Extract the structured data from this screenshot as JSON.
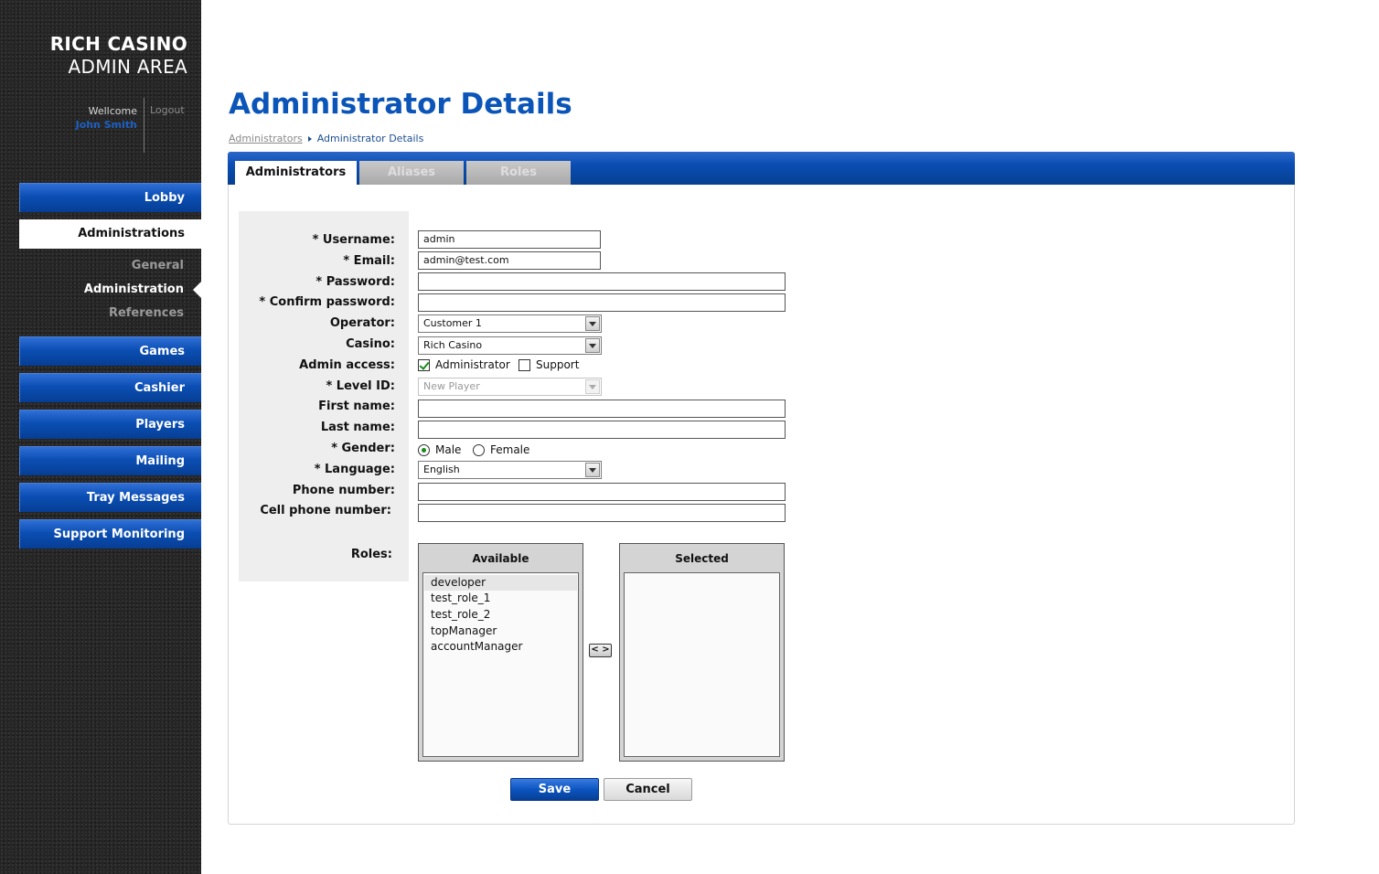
{
  "sidebar": {
    "brand_line1": "RICH CASINO",
    "brand_line2": "ADMIN AREA",
    "welcome_text": "Wellcome",
    "user_name": "John Smith",
    "logout_label": "Logout",
    "nav": {
      "lobby": "Lobby",
      "administrations": "Administrations",
      "games": "Games",
      "cashier": "Cashier",
      "players": "Players",
      "mailing": "Mailing",
      "tray_messages": "Tray Messages",
      "support_monitoring": "Support Monitoring"
    },
    "subnav": {
      "general": "General",
      "administration": "Administration",
      "references": "References"
    }
  },
  "page": {
    "title": "Administrator Details",
    "breadcrumb": [
      "Administrators",
      "Administrator Details"
    ]
  },
  "tabs": [
    "Administrators",
    "Aliases",
    "Roles"
  ],
  "form": {
    "labels": {
      "username": "* Username:",
      "email": "* Email:",
      "password": "* Password:",
      "confirm_password": "* Confirm password:",
      "operator": "Operator:",
      "casino": "Casino:",
      "admin_access": "Admin access:",
      "level_id": "* Level ID:",
      "first_name": "First name:",
      "last_name": "Last name:",
      "gender": "* Gender:",
      "language": "* Language:",
      "phone_number": "Phone number:",
      "cell_phone_number": "Cell phone number:",
      "roles": "Roles:"
    },
    "values": {
      "username": "admin",
      "email": "admin@test.com",
      "password": "",
      "confirm_password": "",
      "operator": "Customer 1",
      "casino": "Rich Casino",
      "level_id": "New Player",
      "first_name": "",
      "last_name": "",
      "language": "English",
      "phone_number": "",
      "cell_phone_number": ""
    },
    "admin_access_options": {
      "administrator": "Administrator",
      "support": "Support"
    },
    "gender_options": {
      "male": "Male",
      "female": "Female"
    },
    "roles": {
      "available_title": "Available",
      "selected_title": "Selected",
      "available": [
        "developer",
        "test_role_1",
        "test_role_2",
        "topManager",
        "accountManager"
      ],
      "selected": [],
      "move_label": "< >"
    },
    "save_label": "Save",
    "cancel_label": "Cancel"
  },
  "colors": {
    "accent_blue": "#0b55b8",
    "nav_blue": "#0b4eb3",
    "check_green": "#1a8a1a"
  }
}
